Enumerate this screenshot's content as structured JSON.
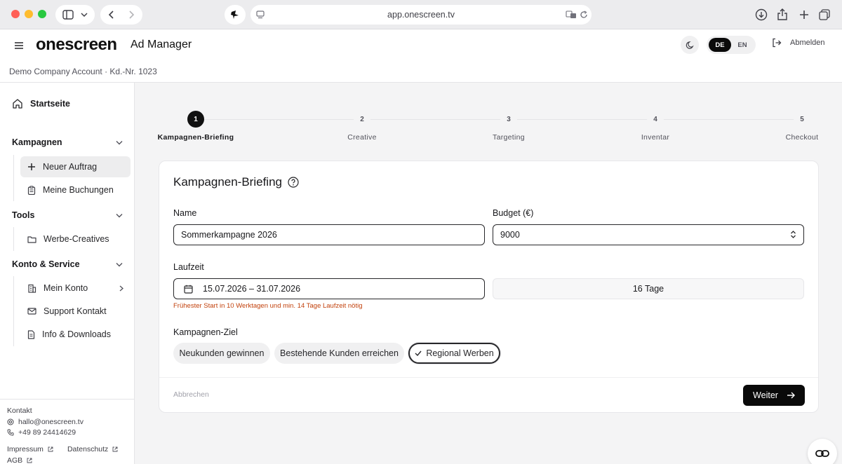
{
  "browser": {
    "url": "app.onescreen.tv"
  },
  "header": {
    "logo": "onescreen",
    "product": "Ad Manager",
    "lang_de": "DE",
    "lang_en": "EN",
    "logout": "Abmelden"
  },
  "account": {
    "label": "Demo Company Account · Kd.-Nr. 1023"
  },
  "sidebar": {
    "home": "Startseite",
    "sections": [
      {
        "title": "Kampagnen",
        "items": [
          {
            "label": "Neuer Auftrag",
            "icon": "plus-icon",
            "active": true
          },
          {
            "label": "Meine Buchungen",
            "icon": "clipboard-icon"
          }
        ]
      },
      {
        "title": "Tools",
        "items": [
          {
            "label": "Werbe-Creatives",
            "icon": "folder-icon"
          }
        ]
      },
      {
        "title": "Konto & Service",
        "items": [
          {
            "label": "Mein Konto",
            "icon": "building-icon"
          },
          {
            "label": "Support Kontakt",
            "icon": "mail-icon"
          },
          {
            "label": "Info & Downloads",
            "icon": "file-icon"
          }
        ]
      }
    ],
    "contact": {
      "title": "Kontakt",
      "email": "hallo@onescreen.tv",
      "phone": "+49 89 24414629"
    },
    "links": {
      "impressum": "Impressum",
      "datenschutz": "Datenschutz",
      "agb": "AGB"
    }
  },
  "stepper": {
    "steps": [
      {
        "number": "1",
        "label": "Kampagnen-Briefing",
        "active": true
      },
      {
        "number": "2",
        "label": "Creative"
      },
      {
        "number": "3",
        "label": "Targeting"
      },
      {
        "number": "4",
        "label": "Inventar"
      },
      {
        "number": "5",
        "label": "Checkout"
      }
    ]
  },
  "form": {
    "title": "Kampagnen-Briefing",
    "name_label": "Name",
    "name_value": "Sommerkampagne 2026",
    "budget_label": "Budget (€)",
    "budget_value": "9000",
    "runtime_label": "Laufzeit",
    "runtime_value": "15.07.2026 – 31.07.2026",
    "runtime_days": "16 Tage",
    "runtime_hint": "Frühester Start in 10 Werktagen und min. 14 Tage Laufzeit nötig",
    "goal_label": "Kampagnen-Ziel",
    "goals": [
      {
        "label": "Neukunden gewinnen"
      },
      {
        "label": "Bestehende Kunden erreichen"
      },
      {
        "label": "Regional Werben",
        "selected": true
      }
    ],
    "cancel": "Abbrechen",
    "next": "Weiter"
  },
  "colors": {
    "accent": "#0a0a0a",
    "hint": "#c2410c",
    "background": "#f4f4f5"
  }
}
